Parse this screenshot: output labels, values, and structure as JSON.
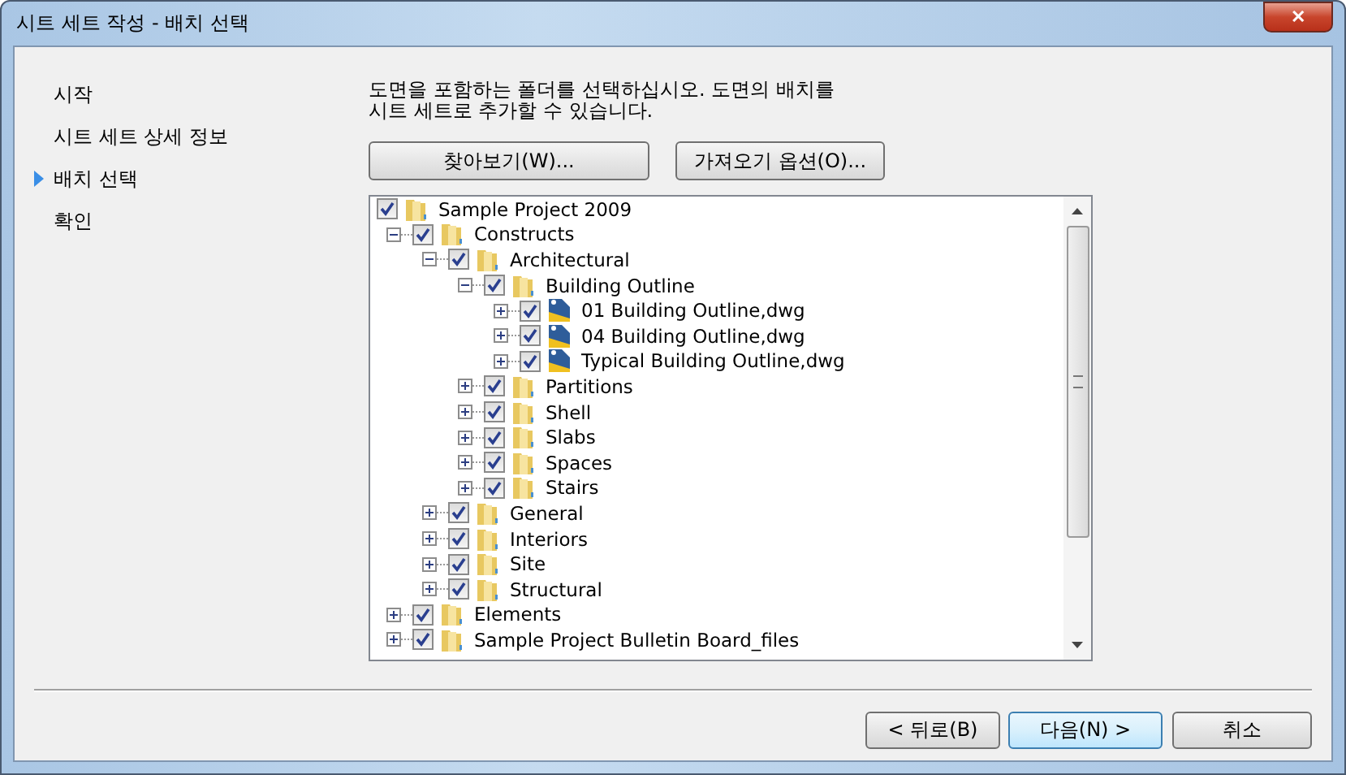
{
  "window": {
    "title": "시트 세트 작성 - 배치 선택",
    "close": "✕"
  },
  "steps": [
    {
      "label": "시작",
      "selected": false
    },
    {
      "label": "시트 세트 상세 정보",
      "selected": false
    },
    {
      "label": "배치 선택",
      "selected": true
    },
    {
      "label": "확인",
      "selected": false
    }
  ],
  "instruction": "도면을 포함하는 폴더를 선택하십시오.  도면의 배치를 시트 세트로 추가할 수 있습니다.",
  "actions": [
    "찾아보기(W)...",
    "가져오기 옵션(O)..."
  ],
  "tree": [
    {
      "label": "Sample Project 2009",
      "kind": "folder",
      "checked": true,
      "children": [
        {
          "label": "Constructs",
          "kind": "folder",
          "checked": true,
          "expanded": true,
          "children": [
            {
              "label": "Architectural",
              "kind": "folder",
              "checked": true,
              "expanded": true,
              "children": [
                {
                  "label": "Building Outline",
                  "kind": "folder",
                  "checked": true,
                  "expanded": true,
                  "children": [
                    {
                      "label": "01 Building Outline,dwg",
                      "kind": "drawing",
                      "checked": true,
                      "expanded": false
                    },
                    {
                      "label": "04 Building Outline,dwg",
                      "kind": "drawing",
                      "checked": true,
                      "expanded": false
                    },
                    {
                      "label": "Typical Building Outline,dwg",
                      "kind": "drawing",
                      "checked": true,
                      "expanded": false
                    }
                  ]
                },
                {
                  "label": "Partitions",
                  "kind": "folder",
                  "checked": true,
                  "expanded": false
                },
                {
                  "label": "Shell",
                  "kind": "folder",
                  "checked": true,
                  "expanded": false
                },
                {
                  "label": "Slabs",
                  "kind": "folder",
                  "checked": true,
                  "expanded": false
                },
                {
                  "label": "Spaces",
                  "kind": "folder",
                  "checked": true,
                  "expanded": false
                },
                {
                  "label": "Stairs",
                  "kind": "folder",
                  "checked": true,
                  "expanded": false
                }
              ]
            },
            {
              "label": "General",
              "kind": "folder",
              "checked": true,
              "expanded": false
            },
            {
              "label": "Interiors",
              "kind": "folder",
              "checked": true,
              "expanded": false
            },
            {
              "label": "Site",
              "kind": "folder",
              "checked": true,
              "expanded": false
            },
            {
              "label": "Structural",
              "kind": "folder",
              "checked": true,
              "expanded": false
            }
          ]
        },
        {
          "label": "Elements",
          "kind": "folder",
          "checked": true,
          "expanded": false
        },
        {
          "label": "Sample Project Bulletin Board_files",
          "kind": "folder",
          "checked": true,
          "expanded": false
        }
      ]
    }
  ],
  "buttons": [
    {
      "label": "< 뒤로(B)",
      "kind": "normal"
    },
    {
      "label": "다음(N) >",
      "kind": "default"
    },
    {
      "label": "취소",
      "kind": "normal"
    }
  ]
}
